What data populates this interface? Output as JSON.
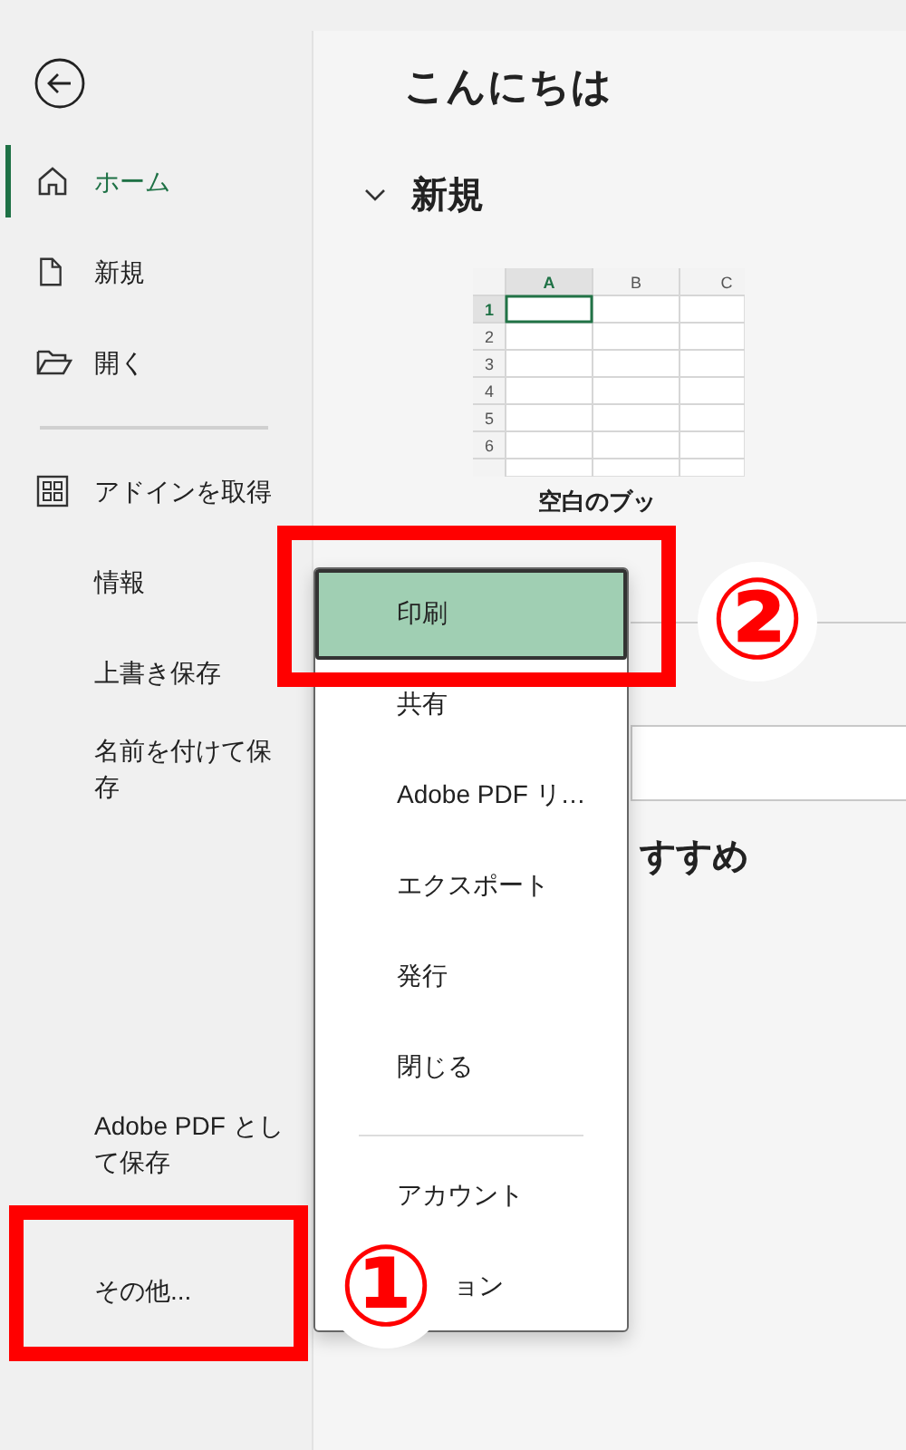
{
  "sidebar": {
    "top_items": [
      {
        "label": "ホーム",
        "kind": "home",
        "selected": true
      },
      {
        "label": "新規",
        "kind": "new",
        "selected": false
      },
      {
        "label": "開く",
        "kind": "open",
        "selected": false
      }
    ],
    "items": [
      {
        "label": "アドインを取得",
        "kind": "addin",
        "selected": false
      },
      {
        "label": "情報",
        "kind": "text",
        "selected": false
      },
      {
        "label": "上書き保存",
        "kind": "text",
        "selected": false
      },
      {
        "label": "名前を付けて保存",
        "kind": "text",
        "selected": false
      }
    ],
    "bottom_items": [
      {
        "label": "Adobe PDF として保存",
        "kind": "text",
        "selected": false
      },
      {
        "label": "その他...",
        "kind": "text",
        "selected": false
      }
    ]
  },
  "main": {
    "greeting": "こんにちは",
    "section": {
      "title": "新規",
      "expanded": true
    },
    "template": {
      "columns": [
        "A",
        "B",
        "C"
      ],
      "rows": [
        "1",
        "2",
        "3",
        "4",
        "5",
        "6"
      ],
      "caption": "空白のブッ"
    },
    "section_2_title": "すすめ"
  },
  "menu": {
    "items": [
      {
        "label": "印刷",
        "kind": "item",
        "selected": true
      },
      {
        "label": "共有",
        "kind": "item",
        "selected": false
      },
      {
        "label": "Adobe PDF リ…",
        "kind": "item",
        "selected": false
      },
      {
        "label": "エクスポート",
        "kind": "item",
        "selected": false
      },
      {
        "label": "発行",
        "kind": "item",
        "selected": false
      },
      {
        "label": "閉じる",
        "kind": "item",
        "selected": false
      }
    ],
    "footer_items": [
      {
        "label": "アカウント",
        "kind": "item",
        "selected": false
      },
      {
        "label": "ョン",
        "kind": "partial",
        "selected": false
      }
    ]
  },
  "annotations": [
    {
      "label": "①"
    },
    {
      "label": "②"
    }
  ]
}
